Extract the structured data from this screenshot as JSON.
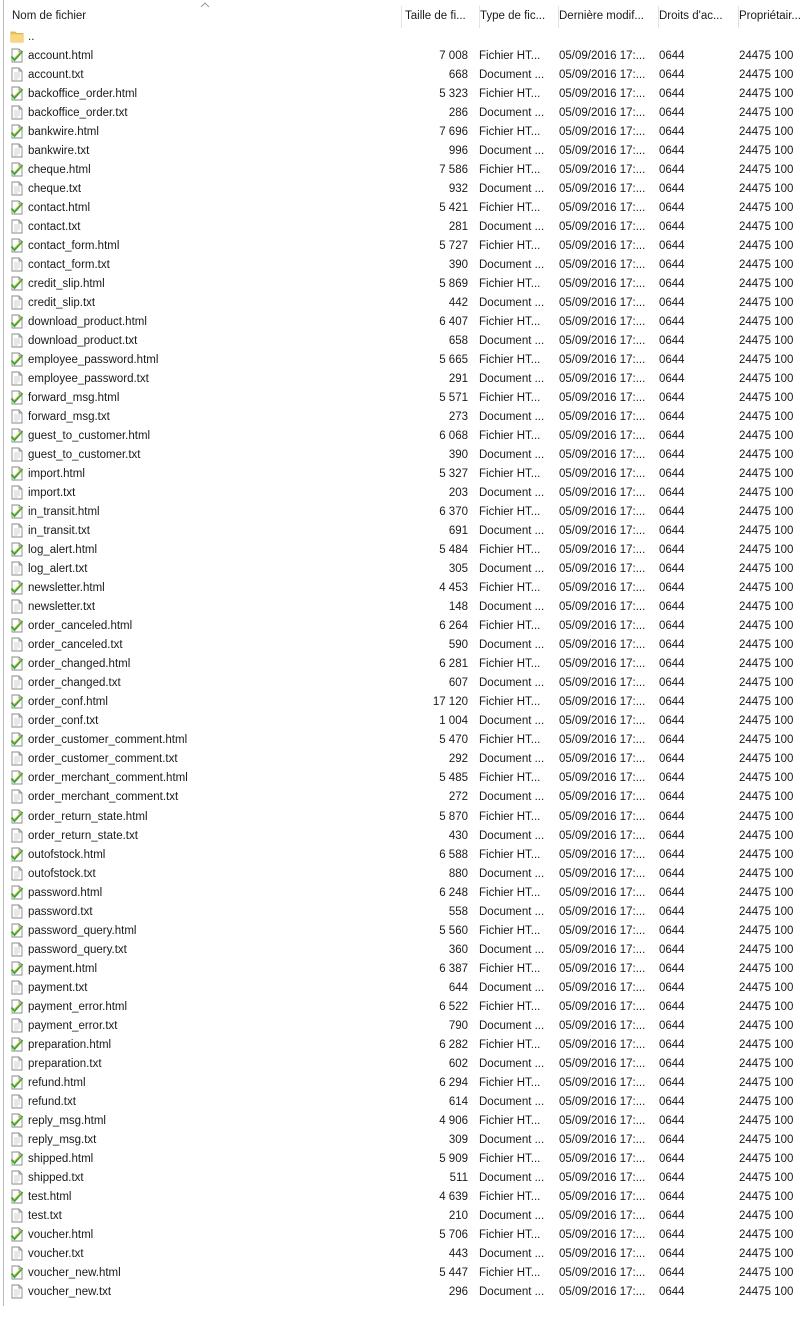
{
  "header": {
    "columns": [
      {
        "key": "name",
        "label": "Nom de fichier"
      },
      {
        "key": "size",
        "label": "Taille de fi..."
      },
      {
        "key": "type",
        "label": "Type de fic..."
      },
      {
        "key": "date",
        "label": "Dernière modif..."
      },
      {
        "key": "perm",
        "label": "Droits d'ac..."
      },
      {
        "key": "owner",
        "label": "Propriétair..."
      }
    ]
  },
  "parent_dir": {
    "name": ".."
  },
  "files": [
    {
      "name": "account.html",
      "size": "7 008",
      "type": "Fichier HT...",
      "date": "05/09/2016 17:...",
      "perm": "0644",
      "owner": "24475 100",
      "icon": "html-file-icon"
    },
    {
      "name": "account.txt",
      "size": "668",
      "type": "Document ...",
      "date": "05/09/2016 17:...",
      "perm": "0644",
      "owner": "24475 100",
      "icon": "text-file-icon"
    },
    {
      "name": "backoffice_order.html",
      "size": "5 323",
      "type": "Fichier HT...",
      "date": "05/09/2016 17:...",
      "perm": "0644",
      "owner": "24475 100",
      "icon": "html-file-icon"
    },
    {
      "name": "backoffice_order.txt",
      "size": "286",
      "type": "Document ...",
      "date": "05/09/2016 17:...",
      "perm": "0644",
      "owner": "24475 100",
      "icon": "text-file-icon"
    },
    {
      "name": "bankwire.html",
      "size": "7 696",
      "type": "Fichier HT...",
      "date": "05/09/2016 17:...",
      "perm": "0644",
      "owner": "24475 100",
      "icon": "html-file-icon"
    },
    {
      "name": "bankwire.txt",
      "size": "996",
      "type": "Document ...",
      "date": "05/09/2016 17:...",
      "perm": "0644",
      "owner": "24475 100",
      "icon": "text-file-icon"
    },
    {
      "name": "cheque.html",
      "size": "7 586",
      "type": "Fichier HT...",
      "date": "05/09/2016 17:...",
      "perm": "0644",
      "owner": "24475 100",
      "icon": "html-file-icon"
    },
    {
      "name": "cheque.txt",
      "size": "932",
      "type": "Document ...",
      "date": "05/09/2016 17:...",
      "perm": "0644",
      "owner": "24475 100",
      "icon": "text-file-icon"
    },
    {
      "name": "contact.html",
      "size": "5 421",
      "type": "Fichier HT...",
      "date": "05/09/2016 17:...",
      "perm": "0644",
      "owner": "24475 100",
      "icon": "html-file-icon"
    },
    {
      "name": "contact.txt",
      "size": "281",
      "type": "Document ...",
      "date": "05/09/2016 17:...",
      "perm": "0644",
      "owner": "24475 100",
      "icon": "text-file-icon"
    },
    {
      "name": "contact_form.html",
      "size": "5 727",
      "type": "Fichier HT...",
      "date": "05/09/2016 17:...",
      "perm": "0644",
      "owner": "24475 100",
      "icon": "html-file-icon"
    },
    {
      "name": "contact_form.txt",
      "size": "390",
      "type": "Document ...",
      "date": "05/09/2016 17:...",
      "perm": "0644",
      "owner": "24475 100",
      "icon": "text-file-icon"
    },
    {
      "name": "credit_slip.html",
      "size": "5 869",
      "type": "Fichier HT...",
      "date": "05/09/2016 17:...",
      "perm": "0644",
      "owner": "24475 100",
      "icon": "html-file-icon"
    },
    {
      "name": "credit_slip.txt",
      "size": "442",
      "type": "Document ...",
      "date": "05/09/2016 17:...",
      "perm": "0644",
      "owner": "24475 100",
      "icon": "text-file-icon"
    },
    {
      "name": "download_product.html",
      "size": "6 407",
      "type": "Fichier HT...",
      "date": "05/09/2016 17:...",
      "perm": "0644",
      "owner": "24475 100",
      "icon": "html-file-icon"
    },
    {
      "name": "download_product.txt",
      "size": "658",
      "type": "Document ...",
      "date": "05/09/2016 17:...",
      "perm": "0644",
      "owner": "24475 100",
      "icon": "text-file-icon"
    },
    {
      "name": "employee_password.html",
      "size": "5 665",
      "type": "Fichier HT...",
      "date": "05/09/2016 17:...",
      "perm": "0644",
      "owner": "24475 100",
      "icon": "html-file-icon"
    },
    {
      "name": "employee_password.txt",
      "size": "291",
      "type": "Document ...",
      "date": "05/09/2016 17:...",
      "perm": "0644",
      "owner": "24475 100",
      "icon": "text-file-icon"
    },
    {
      "name": "forward_msg.html",
      "size": "5 571",
      "type": "Fichier HT...",
      "date": "05/09/2016 17:...",
      "perm": "0644",
      "owner": "24475 100",
      "icon": "html-file-icon"
    },
    {
      "name": "forward_msg.txt",
      "size": "273",
      "type": "Document ...",
      "date": "05/09/2016 17:...",
      "perm": "0644",
      "owner": "24475 100",
      "icon": "text-file-icon"
    },
    {
      "name": "guest_to_customer.html",
      "size": "6 068",
      "type": "Fichier HT...",
      "date": "05/09/2016 17:...",
      "perm": "0644",
      "owner": "24475 100",
      "icon": "html-file-icon"
    },
    {
      "name": "guest_to_customer.txt",
      "size": "390",
      "type": "Document ...",
      "date": "05/09/2016 17:...",
      "perm": "0644",
      "owner": "24475 100",
      "icon": "text-file-icon"
    },
    {
      "name": "import.html",
      "size": "5 327",
      "type": "Fichier HT...",
      "date": "05/09/2016 17:...",
      "perm": "0644",
      "owner": "24475 100",
      "icon": "html-file-icon"
    },
    {
      "name": "import.txt",
      "size": "203",
      "type": "Document ...",
      "date": "05/09/2016 17:...",
      "perm": "0644",
      "owner": "24475 100",
      "icon": "text-file-icon"
    },
    {
      "name": "in_transit.html",
      "size": "6 370",
      "type": "Fichier HT...",
      "date": "05/09/2016 17:...",
      "perm": "0644",
      "owner": "24475 100",
      "icon": "html-file-icon"
    },
    {
      "name": "in_transit.txt",
      "size": "691",
      "type": "Document ...",
      "date": "05/09/2016 17:...",
      "perm": "0644",
      "owner": "24475 100",
      "icon": "text-file-icon"
    },
    {
      "name": "log_alert.html",
      "size": "5 484",
      "type": "Fichier HT...",
      "date": "05/09/2016 17:...",
      "perm": "0644",
      "owner": "24475 100",
      "icon": "html-file-icon"
    },
    {
      "name": "log_alert.txt",
      "size": "305",
      "type": "Document ...",
      "date": "05/09/2016 17:...",
      "perm": "0644",
      "owner": "24475 100",
      "icon": "text-file-icon"
    },
    {
      "name": "newsletter.html",
      "size": "4 453",
      "type": "Fichier HT...",
      "date": "05/09/2016 17:...",
      "perm": "0644",
      "owner": "24475 100",
      "icon": "html-file-icon"
    },
    {
      "name": "newsletter.txt",
      "size": "148",
      "type": "Document ...",
      "date": "05/09/2016 17:...",
      "perm": "0644",
      "owner": "24475 100",
      "icon": "text-file-icon"
    },
    {
      "name": "order_canceled.html",
      "size": "6 264",
      "type": "Fichier HT...",
      "date": "05/09/2016 17:...",
      "perm": "0644",
      "owner": "24475 100",
      "icon": "html-file-icon"
    },
    {
      "name": "order_canceled.txt",
      "size": "590",
      "type": "Document ...",
      "date": "05/09/2016 17:...",
      "perm": "0644",
      "owner": "24475 100",
      "icon": "text-file-icon"
    },
    {
      "name": "order_changed.html",
      "size": "6 281",
      "type": "Fichier HT...",
      "date": "05/09/2016 17:...",
      "perm": "0644",
      "owner": "24475 100",
      "icon": "html-file-icon"
    },
    {
      "name": "order_changed.txt",
      "size": "607",
      "type": "Document ...",
      "date": "05/09/2016 17:...",
      "perm": "0644",
      "owner": "24475 100",
      "icon": "text-file-icon"
    },
    {
      "name": "order_conf.html",
      "size": "17 120",
      "type": "Fichier HT...",
      "date": "05/09/2016 17:...",
      "perm": "0644",
      "owner": "24475 100",
      "icon": "html-file-icon"
    },
    {
      "name": "order_conf.txt",
      "size": "1 004",
      "type": "Document ...",
      "date": "05/09/2016 17:...",
      "perm": "0644",
      "owner": "24475 100",
      "icon": "text-file-icon"
    },
    {
      "name": "order_customer_comment.html",
      "size": "5 470",
      "type": "Fichier HT...",
      "date": "05/09/2016 17:...",
      "perm": "0644",
      "owner": "24475 100",
      "icon": "html-file-icon"
    },
    {
      "name": "order_customer_comment.txt",
      "size": "292",
      "type": "Document ...",
      "date": "05/09/2016 17:...",
      "perm": "0644",
      "owner": "24475 100",
      "icon": "text-file-icon"
    },
    {
      "name": "order_merchant_comment.html",
      "size": "5 485",
      "type": "Fichier HT...",
      "date": "05/09/2016 17:...",
      "perm": "0644",
      "owner": "24475 100",
      "icon": "html-file-icon"
    },
    {
      "name": "order_merchant_comment.txt",
      "size": "272",
      "type": "Document ...",
      "date": "05/09/2016 17:...",
      "perm": "0644",
      "owner": "24475 100",
      "icon": "text-file-icon"
    },
    {
      "name": "order_return_state.html",
      "size": "5 870",
      "type": "Fichier HT...",
      "date": "05/09/2016 17:...",
      "perm": "0644",
      "owner": "24475 100",
      "icon": "html-file-icon",
      "gap": true
    },
    {
      "name": "order_return_state.txt",
      "size": "430",
      "type": "Document ...",
      "date": "05/09/2016 17:...",
      "perm": "0644",
      "owner": "24475 100",
      "icon": "text-file-icon"
    },
    {
      "name": "outofstock.html",
      "size": "6 588",
      "type": "Fichier HT...",
      "date": "05/09/2016 17:...",
      "perm": "0644",
      "owner": "24475 100",
      "icon": "html-file-icon"
    },
    {
      "name": "outofstock.txt",
      "size": "880",
      "type": "Document ...",
      "date": "05/09/2016 17:...",
      "perm": "0644",
      "owner": "24475 100",
      "icon": "text-file-icon"
    },
    {
      "name": "password.html",
      "size": "6 248",
      "type": "Fichier HT...",
      "date": "05/09/2016 17:...",
      "perm": "0644",
      "owner": "24475 100",
      "icon": "html-file-icon"
    },
    {
      "name": "password.txt",
      "size": "558",
      "type": "Document ...",
      "date": "05/09/2016 17:...",
      "perm": "0644",
      "owner": "24475 100",
      "icon": "text-file-icon"
    },
    {
      "name": "password_query.html",
      "size": "5 560",
      "type": "Fichier HT...",
      "date": "05/09/2016 17:...",
      "perm": "0644",
      "owner": "24475 100",
      "icon": "html-file-icon"
    },
    {
      "name": "password_query.txt",
      "size": "360",
      "type": "Document ...",
      "date": "05/09/2016 17:...",
      "perm": "0644",
      "owner": "24475 100",
      "icon": "text-file-icon"
    },
    {
      "name": "payment.html",
      "size": "6 387",
      "type": "Fichier HT...",
      "date": "05/09/2016 17:...",
      "perm": "0644",
      "owner": "24475 100",
      "icon": "html-file-icon"
    },
    {
      "name": "payment.txt",
      "size": "644",
      "type": "Document ...",
      "date": "05/09/2016 17:...",
      "perm": "0644",
      "owner": "24475 100",
      "icon": "text-file-icon"
    },
    {
      "name": "payment_error.html",
      "size": "6 522",
      "type": "Fichier HT...",
      "date": "05/09/2016 17:...",
      "perm": "0644",
      "owner": "24475 100",
      "icon": "html-file-icon"
    },
    {
      "name": "payment_error.txt",
      "size": "790",
      "type": "Document ...",
      "date": "05/09/2016 17:...",
      "perm": "0644",
      "owner": "24475 100",
      "icon": "text-file-icon"
    },
    {
      "name": "preparation.html",
      "size": "6 282",
      "type": "Fichier HT...",
      "date": "05/09/2016 17:...",
      "perm": "0644",
      "owner": "24475 100",
      "icon": "html-file-icon"
    },
    {
      "name": "preparation.txt",
      "size": "602",
      "type": "Document ...",
      "date": "05/09/2016 17:...",
      "perm": "0644",
      "owner": "24475 100",
      "icon": "text-file-icon"
    },
    {
      "name": "refund.html",
      "size": "6 294",
      "type": "Fichier HT...",
      "date": "05/09/2016 17:...",
      "perm": "0644",
      "owner": "24475 100",
      "icon": "html-file-icon"
    },
    {
      "name": "refund.txt",
      "size": "614",
      "type": "Document ...",
      "date": "05/09/2016 17:...",
      "perm": "0644",
      "owner": "24475 100",
      "icon": "text-file-icon"
    },
    {
      "name": "reply_msg.html",
      "size": "4 906",
      "type": "Fichier HT...",
      "date": "05/09/2016 17:...",
      "perm": "0644",
      "owner": "24475 100",
      "icon": "html-file-icon"
    },
    {
      "name": "reply_msg.txt",
      "size": "309",
      "type": "Document ...",
      "date": "05/09/2016 17:...",
      "perm": "0644",
      "owner": "24475 100",
      "icon": "text-file-icon"
    },
    {
      "name": "shipped.html",
      "size": "5 909",
      "type": "Fichier HT...",
      "date": "05/09/2016 17:...",
      "perm": "0644",
      "owner": "24475 100",
      "icon": "html-file-icon"
    },
    {
      "name": "shipped.txt",
      "size": "511",
      "type": "Document ...",
      "date": "05/09/2016 17:...",
      "perm": "0644",
      "owner": "24475 100",
      "icon": "text-file-icon"
    },
    {
      "name": "test.html",
      "size": "4 639",
      "type": "Fichier HT...",
      "date": "05/09/2016 17:...",
      "perm": "0644",
      "owner": "24475 100",
      "icon": "html-file-icon"
    },
    {
      "name": "test.txt",
      "size": "210",
      "type": "Document ...",
      "date": "05/09/2016 17:...",
      "perm": "0644",
      "owner": "24475 100",
      "icon": "text-file-icon"
    },
    {
      "name": "voucher.html",
      "size": "5 706",
      "type": "Fichier HT...",
      "date": "05/09/2016 17:...",
      "perm": "0644",
      "owner": "24475 100",
      "icon": "html-file-icon"
    },
    {
      "name": "voucher.txt",
      "size": "443",
      "type": "Document ...",
      "date": "05/09/2016 17:...",
      "perm": "0644",
      "owner": "24475 100",
      "icon": "text-file-icon"
    },
    {
      "name": "voucher_new.html",
      "size": "5 447",
      "type": "Fichier HT...",
      "date": "05/09/2016 17:...",
      "perm": "0644",
      "owner": "24475 100",
      "icon": "html-file-icon"
    },
    {
      "name": "voucher_new.txt",
      "size": "296",
      "type": "Document ...",
      "date": "05/09/2016 17:...",
      "perm": "0644",
      "owner": "24475 100",
      "icon": "text-file-icon"
    }
  ],
  "colors": {
    "text": "#1a1a1a",
    "background": "#ffffff",
    "folder": "#f2c35c",
    "html_icon_check": "#3fa535",
    "doc_icon_border": "#8a8a8a"
  }
}
